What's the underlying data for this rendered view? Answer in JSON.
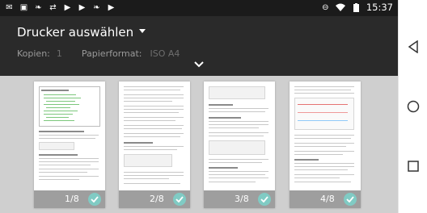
{
  "status_bar": {
    "left_icons": [
      "gmail-icon",
      "image-icon",
      "evernote-icon",
      "sync-icon",
      "youtube-icon",
      "youtube-icon",
      "evernote-icon",
      "youtube-icon"
    ],
    "right_icons": [
      "do-not-disturb-icon",
      "wifi-icon",
      "battery-icon"
    ],
    "time": "15:37"
  },
  "header": {
    "printer_select": "Drucker auswählen",
    "copies_label": "Kopien:",
    "copies_value": "1",
    "paper_label": "Papierformat:",
    "paper_value": "ISO A4"
  },
  "pages": [
    {
      "number": "1/8",
      "selected": true
    },
    {
      "number": "2/8",
      "selected": true
    },
    {
      "number": "3/8",
      "selected": true
    },
    {
      "number": "4/8",
      "selected": true
    }
  ],
  "navigation": [
    "back-icon",
    "home-icon",
    "recents-icon"
  ],
  "colors": {
    "header_bg": "#2a2a2a",
    "check_accent": "#80cbc4",
    "page_footer": "#9e9e9e"
  }
}
